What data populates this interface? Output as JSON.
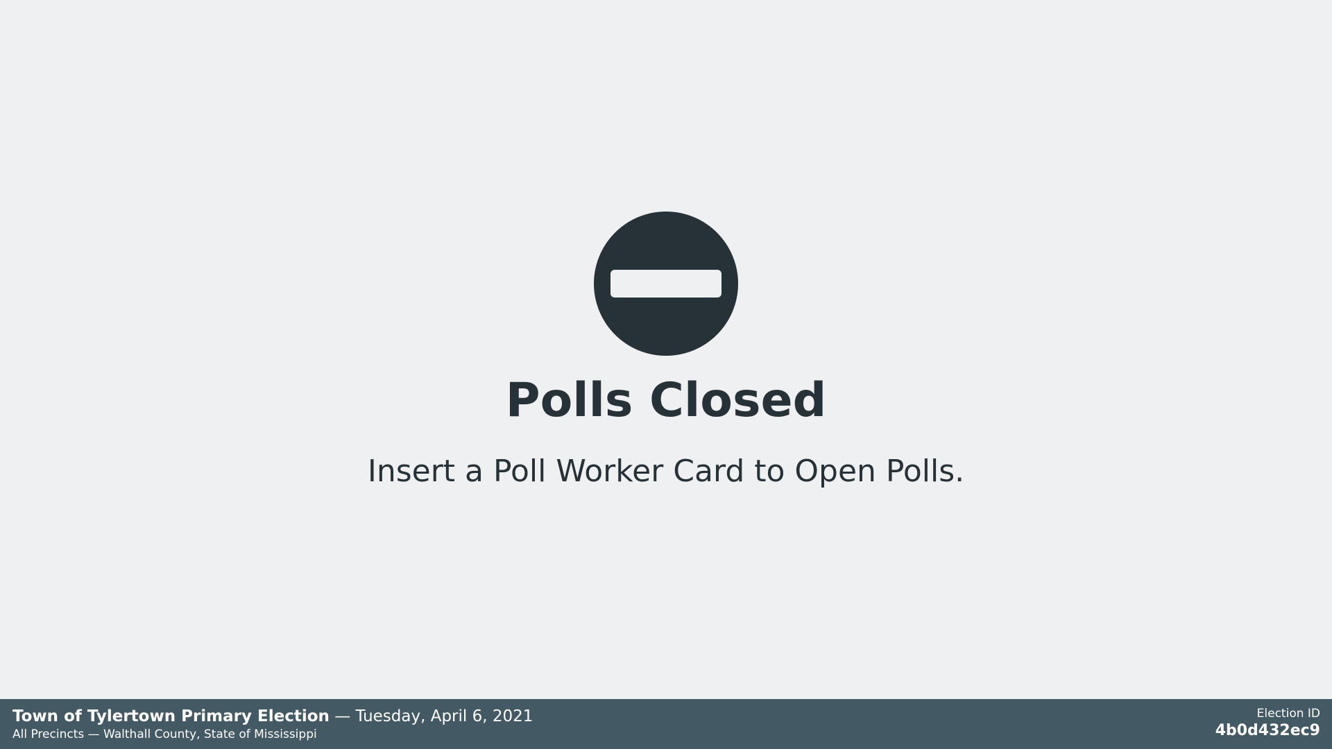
{
  "status": {
    "icon": "no-entry-icon",
    "title": "Polls Closed",
    "message": "Insert a Poll Worker Card to Open Polls."
  },
  "footer": {
    "election_title": "Town of Tylertown Primary Election",
    "date_separator": "—",
    "election_date": "Tuesday, April 6, 2021",
    "precinct_line": "All Precincts — Walthall County, State of Mississippi",
    "election_id_label": "Election ID",
    "election_id_value": "4b0d432ec9"
  },
  "colors": {
    "background": "#eff0f2",
    "text": "#263238",
    "footer_background": "#435964",
    "footer_text": "#ffffff"
  }
}
